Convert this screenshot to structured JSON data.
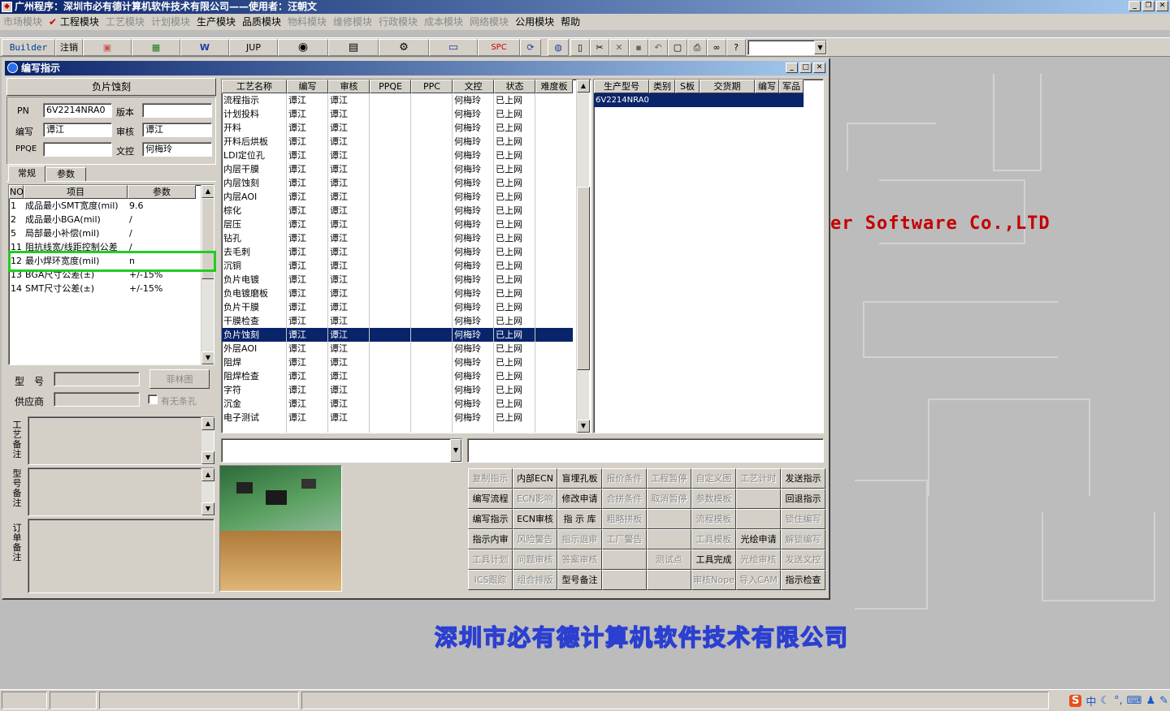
{
  "app": {
    "title": "广州程序：深圳市必有德计算机软件技术有限公司——使用者：汪朝文",
    "icon": "app-icon"
  },
  "menus": [
    {
      "label": "市场模块",
      "enabled": false
    },
    {
      "label": "工程模块",
      "enabled": true,
      "checked": true
    },
    {
      "label": "工艺模块",
      "enabled": false
    },
    {
      "label": "计划模块",
      "enabled": false
    },
    {
      "label": "生产模块",
      "enabled": true
    },
    {
      "label": "品质模块",
      "enabled": true
    },
    {
      "label": "物料模块",
      "enabled": false
    },
    {
      "label": "维修模块",
      "enabled": false
    },
    {
      "label": "行政模块",
      "enabled": false
    },
    {
      "label": "成本模块",
      "enabled": false
    },
    {
      "label": "网络模块",
      "enabled": false
    },
    {
      "label": "公用模块",
      "enabled": true
    },
    {
      "label": "帮助",
      "enabled": true
    }
  ],
  "toolbar": {
    "builder": "Builder",
    "logout": "注销",
    "jup": "JUP",
    "spc": "SPC",
    "icons": [
      "powerpoint-icon",
      "excel-icon",
      "word-icon",
      "eye-icon",
      "database-icon",
      "network-icon",
      "computer-icon",
      "refresh-icon",
      "globe-icon",
      "new-file-icon",
      "cut-icon",
      "delete-icon",
      "save-icon",
      "undo-icon",
      "preview-icon",
      "print-icon",
      "binoculars-icon",
      "help-icon"
    ]
  },
  "window": {
    "title": "编写指示",
    "process_name": "负片蚀刻",
    "pn_label": "PN",
    "pn_value": "6V2214NRA0",
    "version_label": "版本",
    "version_value": "",
    "writer_label": "编写",
    "writer_value": "谭江",
    "reviewer_label": "审核",
    "reviewer_value": "谭江",
    "ppqe_label": "PPQE",
    "ppqe_value": "",
    "doc_control_label": "文控",
    "doc_control_value": "何梅玲",
    "tabs": [
      "常规",
      "参数"
    ],
    "params_headers": [
      "NO",
      "项目",
      "参数"
    ],
    "params_rows": [
      {
        "no": "1",
        "item": "成品最小SMT宽度(mil)",
        "value": "9.6"
      },
      {
        "no": "2",
        "item": "成品最小BGA(mil)",
        "value": "/"
      },
      {
        "no": "5",
        "item": "局部最小补偿(mil)",
        "value": "/"
      },
      {
        "no": "11",
        "item": "阻抗线宽/线距控制公差",
        "value": "/"
      },
      {
        "no": "12",
        "item": "最小焊环宽度(mil)",
        "value": "n"
      },
      {
        "no": "13",
        "item": "BGA尺寸公差(±)",
        "value": "+/-15%"
      },
      {
        "no": "14",
        "item": "SMT尺寸公差(±)",
        "value": "+/-15%"
      }
    ],
    "model_label": "型　号",
    "model_value": "",
    "film_button": "菲林图",
    "supplier_label": "供应商",
    "supplier_value": "",
    "no_slot_label": "有无条孔",
    "no_slot_checked": false,
    "craft_note_label": "工艺备注",
    "model_note_label": "型号备注",
    "order_note_label": "订单备注"
  },
  "process_grid": {
    "headers": [
      "工艺名称",
      "编写",
      "审核",
      "PPQE",
      "PPC",
      "文控",
      "状态",
      "难度板"
    ],
    "selected_index": 17,
    "rows": [
      [
        "流程指示",
        "谭江",
        "谭江",
        "",
        "",
        "何梅玲",
        "已上网",
        ""
      ],
      [
        "计划投料",
        "谭江",
        "谭江",
        "",
        "",
        "何梅玲",
        "已上网",
        ""
      ],
      [
        "开料",
        "谭江",
        "谭江",
        "",
        "",
        "何梅玲",
        "已上网",
        ""
      ],
      [
        "开料后烘板",
        "谭江",
        "谭江",
        "",
        "",
        "何梅玲",
        "已上网",
        ""
      ],
      [
        "LDI定位孔",
        "谭江",
        "谭江",
        "",
        "",
        "何梅玲",
        "已上网",
        ""
      ],
      [
        "内层干膜",
        "谭江",
        "谭江",
        "",
        "",
        "何梅玲",
        "已上网",
        ""
      ],
      [
        "内层蚀刻",
        "谭江",
        "谭江",
        "",
        "",
        "何梅玲",
        "已上网",
        ""
      ],
      [
        "内层AOI",
        "谭江",
        "谭江",
        "",
        "",
        "何梅玲",
        "已上网",
        ""
      ],
      [
        "棕化",
        "谭江",
        "谭江",
        "",
        "",
        "何梅玲",
        "已上网",
        ""
      ],
      [
        "层压",
        "谭江",
        "谭江",
        "",
        "",
        "何梅玲",
        "已上网",
        ""
      ],
      [
        "钻孔",
        "谭江",
        "谭江",
        "",
        "",
        "何梅玲",
        "已上网",
        ""
      ],
      [
        "去毛刺",
        "谭江",
        "谭江",
        "",
        "",
        "何梅玲",
        "已上网",
        ""
      ],
      [
        "沉铜",
        "谭江",
        "谭江",
        "",
        "",
        "何梅玲",
        "已上网",
        ""
      ],
      [
        "负片电镀",
        "谭江",
        "谭江",
        "",
        "",
        "何梅玲",
        "已上网",
        ""
      ],
      [
        "负电镀磨板",
        "谭江",
        "谭江",
        "",
        "",
        "何梅玲",
        "已上网",
        ""
      ],
      [
        "负片干膜",
        "谭江",
        "谭江",
        "",
        "",
        "何梅玲",
        "已上网",
        ""
      ],
      [
        "干膜检查",
        "谭江",
        "谭江",
        "",
        "",
        "何梅玲",
        "已上网",
        ""
      ],
      [
        "负片蚀刻",
        "谭江",
        "谭江",
        "",
        "",
        "何梅玲",
        "已上网",
        ""
      ],
      [
        "外层AOI",
        "谭江",
        "谭江",
        "",
        "",
        "何梅玲",
        "已上网",
        ""
      ],
      [
        "阻焊",
        "谭江",
        "谭江",
        "",
        "",
        "何梅玲",
        "已上网",
        ""
      ],
      [
        "阻焊检查",
        "谭江",
        "谭江",
        "",
        "",
        "何梅玲",
        "已上网",
        ""
      ],
      [
        "字符",
        "谭江",
        "谭江",
        "",
        "",
        "何梅玲",
        "已上网",
        ""
      ],
      [
        "沉金",
        "谭江",
        "谭江",
        "",
        "",
        "何梅玲",
        "已上网",
        ""
      ],
      [
        "电子测试",
        "谭江",
        "谭江",
        "",
        "",
        "何梅玲",
        "已上网",
        ""
      ]
    ]
  },
  "product_grid": {
    "headers": [
      "生产型号",
      "类别",
      "S板",
      "交货期",
      "编写",
      "军品"
    ],
    "rows": [
      [
        "6V2214NRA0",
        "",
        "",
        "",
        "",
        ""
      ]
    ]
  },
  "action_buttons": [
    [
      {
        "label": "复制指示",
        "enabled": false
      },
      {
        "label": "内部ECN",
        "enabled": true
      },
      {
        "label": "盲埋孔板",
        "enabled": true
      },
      {
        "label": "报价条件",
        "enabled": false
      },
      {
        "label": "工程暂停",
        "enabled": false
      },
      {
        "label": "自定义图",
        "enabled": false
      },
      {
        "label": "工艺计时",
        "enabled": false
      },
      {
        "label": "发送指示",
        "enabled": true
      }
    ],
    [
      {
        "label": "编写流程",
        "enabled": true
      },
      {
        "label": "ECN影响",
        "enabled": false
      },
      {
        "label": "修改申请",
        "enabled": true
      },
      {
        "label": "合拼条件",
        "enabled": false
      },
      {
        "label": "取消暂停",
        "enabled": false
      },
      {
        "label": "参数模板",
        "enabled": false
      },
      {
        "label": "",
        "enabled": false
      },
      {
        "label": "回退指示",
        "enabled": true
      }
    ],
    [
      {
        "label": "编写指示",
        "enabled": true
      },
      {
        "label": "ECN审核",
        "enabled": true
      },
      {
        "label": "指 示 库",
        "enabled": true
      },
      {
        "label": "粗略拼板",
        "enabled": false
      },
      {
        "label": "",
        "enabled": false
      },
      {
        "label": "流程模板",
        "enabled": false
      },
      {
        "label": "",
        "enabled": false
      },
      {
        "label": "锁住编写",
        "enabled": false
      }
    ],
    [
      {
        "label": "指示内审",
        "enabled": true
      },
      {
        "label": "风险警告",
        "enabled": false
      },
      {
        "label": "指示退审",
        "enabled": false
      },
      {
        "label": "工厂警告",
        "enabled": false
      },
      {
        "label": "",
        "enabled": false
      },
      {
        "label": "工具模板",
        "enabled": false
      },
      {
        "label": "光绘申请",
        "enabled": true
      },
      {
        "label": "解锁编写",
        "enabled": false
      }
    ],
    [
      {
        "label": "工具计划",
        "enabled": false
      },
      {
        "label": "问题审核",
        "enabled": false
      },
      {
        "label": "答案审核",
        "enabled": false
      },
      {
        "label": "",
        "enabled": false
      },
      {
        "label": "测试点",
        "enabled": false
      },
      {
        "label": "工具完成",
        "enabled": true
      },
      {
        "label": "光绘审核",
        "enabled": false
      },
      {
        "label": "发送文控",
        "enabled": false
      }
    ],
    [
      {
        "label": "ICS跟踪",
        "enabled": false
      },
      {
        "label": "组合排版",
        "enabled": false
      },
      {
        "label": "型号备注",
        "enabled": true
      },
      {
        "label": "",
        "enabled": false
      },
      {
        "label": "",
        "enabled": false
      },
      {
        "label": "审核Nope",
        "enabled": false
      },
      {
        "label": "导入CAM",
        "enabled": false
      },
      {
        "label": "指示检查",
        "enabled": true
      }
    ]
  ],
  "background": {
    "logo_text": "er Software Co.,LTD",
    "company_name": "深圳市必有德计算机软件技术有限公司"
  },
  "status_bar": {
    "ime_text": "中",
    "ime_icons": [
      "sogou-icon",
      "moon-icon",
      "punctuation-icon",
      "keyboard-icon",
      "skin-icon",
      "wrench-icon"
    ]
  },
  "colors": {
    "title_gradient_start": "#0a246a",
    "selection": "#0a246a",
    "highlight_box": "#22cc22",
    "logo_red": "#c40000",
    "company_blue": "#2b3fd0"
  }
}
